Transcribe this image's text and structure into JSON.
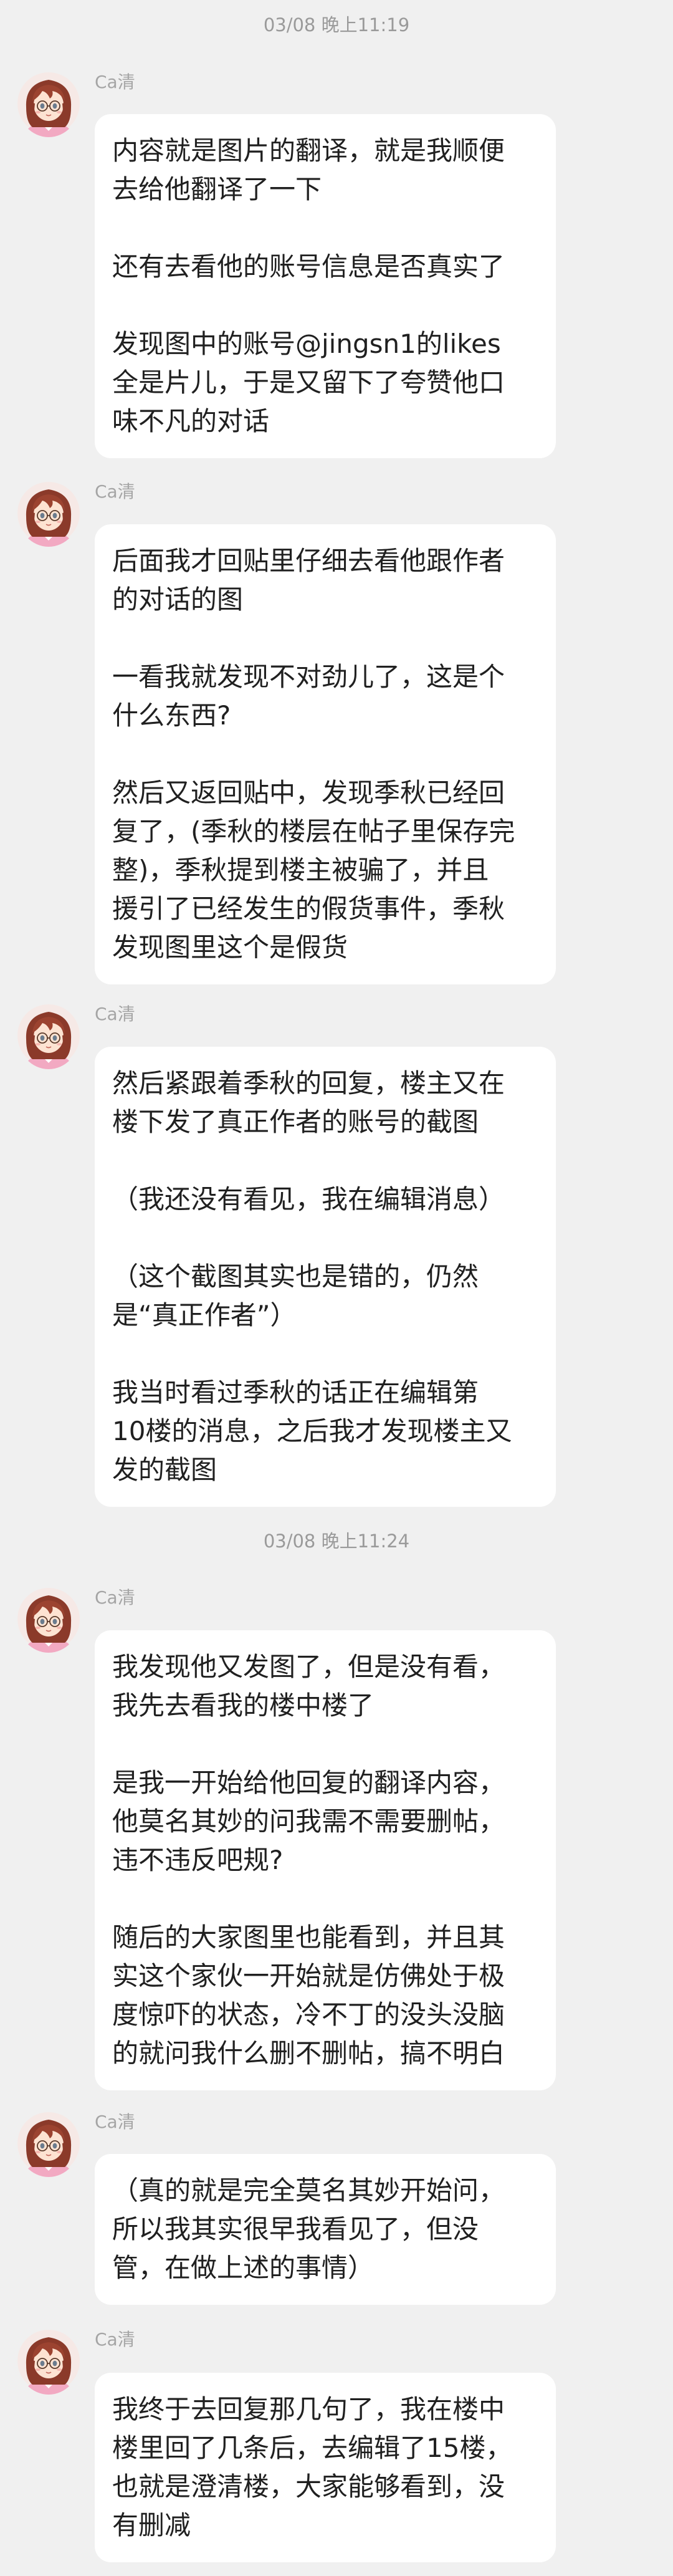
{
  "timestamps": [
    "03/08 晚上11:19",
    "03/08 晚上11:24"
  ],
  "messages": [
    {
      "sender": "Ca清",
      "paragraphs": [
        "内容就是图片的翻译，就是我顺便\n去给他翻译了一下",
        "还有去看他的账号信息是否真实了",
        "发现图中的账号@jingsn1的likes\n全是片儿，于是又留下了夸赞他口\n味不凡的对话"
      ]
    },
    {
      "sender": "Ca清",
      "paragraphs": [
        "后面我才回贴里仔细去看他跟作者\n的对话的图",
        "一看我就发现不对劲儿了，这是个\n什么东西?",
        "然后又返回贴中，发现季秋已经回\n复了，(季秋的楼层在帖子里保存完\n整)，季秋提到楼主被骗了，并且\n援引了已经发生的假货事件，季秋\n发现图里这个是假货"
      ]
    },
    {
      "sender": "Ca清",
      "paragraphs": [
        "然后紧跟着季秋的回复，楼主又在\n楼下发了真正作者的账号的截图",
        "（我还没有看见，我在编辑消息）",
        "（这个截图其实也是错的，仍然\n是“真正作者”）",
        "我当时看过季秋的话正在编辑第\n10楼的消息，之后我才发现楼主又\n发的截图"
      ]
    },
    {
      "sender": "Ca清",
      "paragraphs": [
        "我发现他又发图了，但是没有看，\n我先去看我的楼中楼了",
        "是我一开始给他回复的翻译内容，\n他莫名其妙的问我需不需要删帖，\n违不违反吧规?",
        "随后的大家图里也能看到，并且其\n实这个家伙一开始就是仿佛处于极\n度惊吓的状态，冷不丁的没头没脑\n的就问我什么删不删帖，搞不明白"
      ]
    },
    {
      "sender": "Ca清",
      "paragraphs": [
        "（真的就是完全莫名其妙开始问，\n所以我其实很早我看见了，但没\n管，在做上述的事情）"
      ]
    },
    {
      "sender": "Ca清",
      "paragraphs": [
        "我终于去回复那几句了，我在楼中\n楼里回了几条后，去编辑了15楼，\n也就是澄清楼，大家能够看到，没\n有删减"
      ]
    }
  ]
}
